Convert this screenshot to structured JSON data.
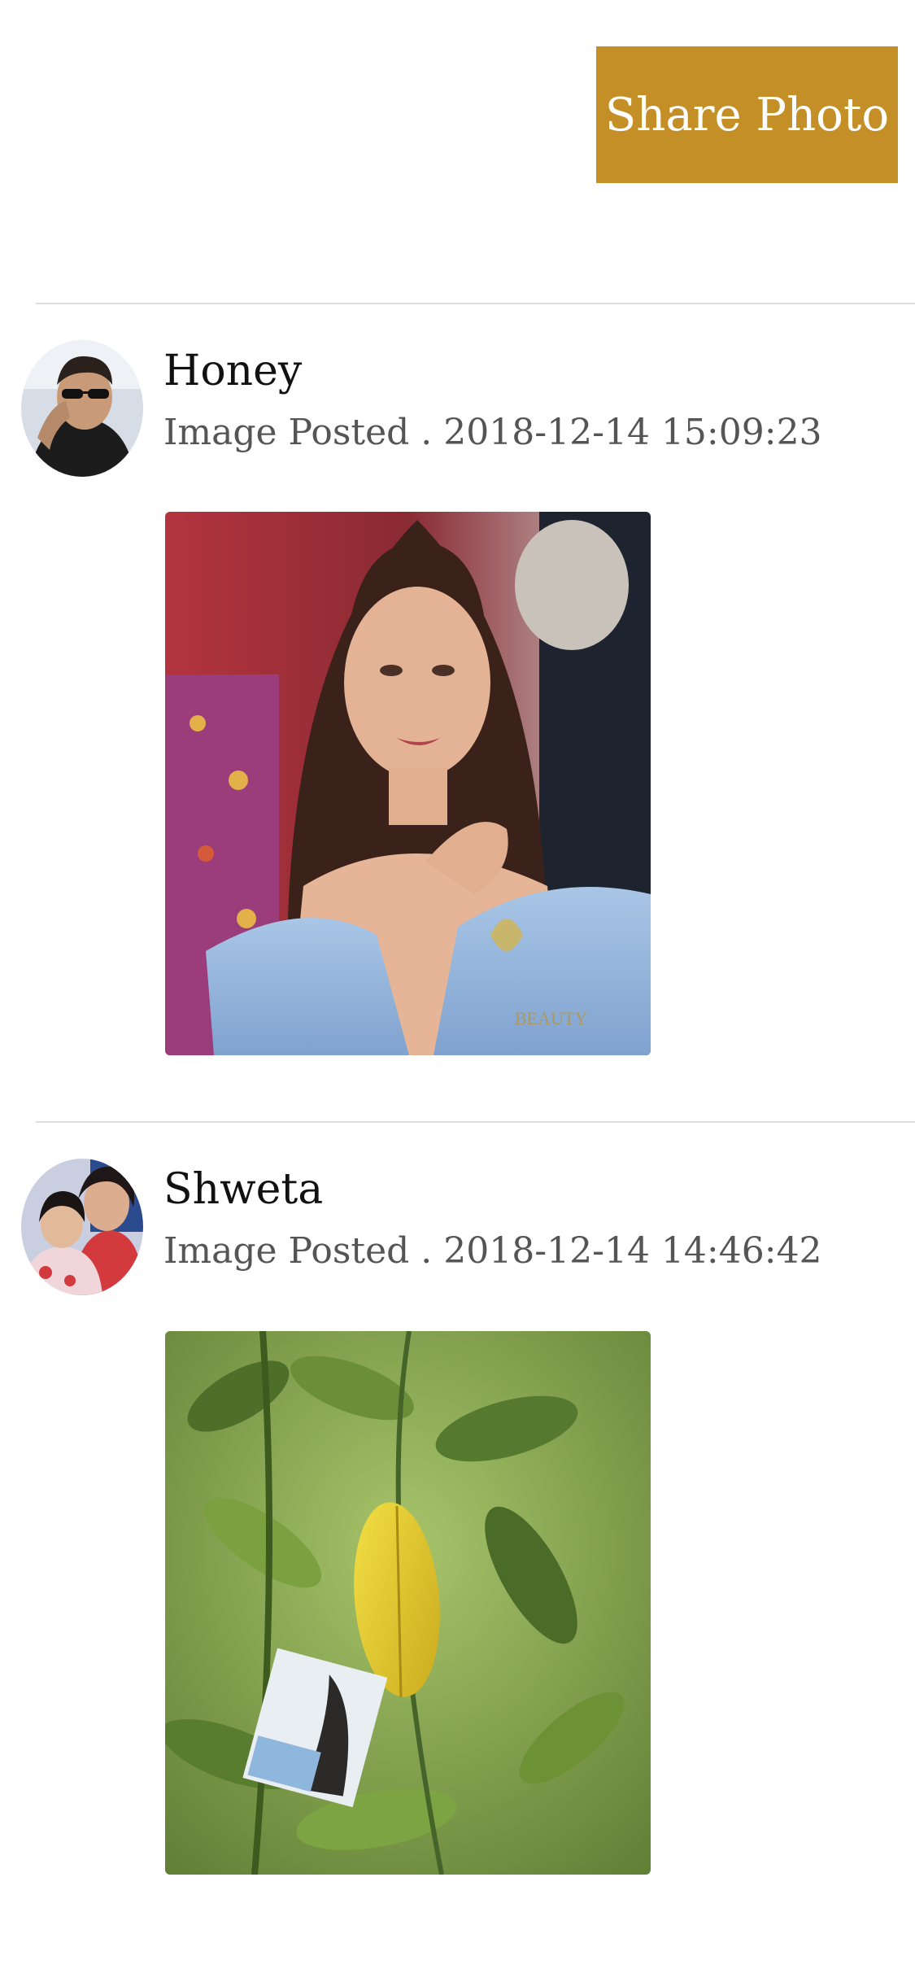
{
  "header": {
    "share_label": "Share Photo",
    "accent_color": "#c48f26"
  },
  "posts": [
    {
      "username": "Honey",
      "meta": "Image Posted . 2018-12-14 15:09:23",
      "avatar_icon": "user-avatar-man-sunglasses",
      "photo_icon": "portrait-woman-blue-dress"
    },
    {
      "username": "Shweta",
      "meta": "Image Posted . 2018-12-14 14:46:42",
      "avatar_icon": "user-avatar-mother-child",
      "photo_icon": "green-leaves-photo"
    }
  ]
}
